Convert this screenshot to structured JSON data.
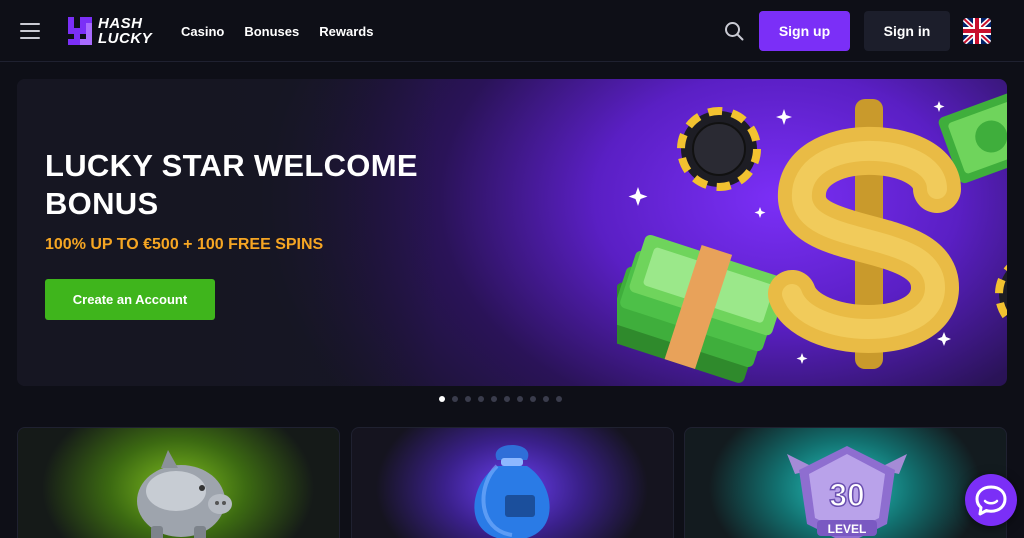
{
  "header": {
    "logo_line1": "HASH",
    "logo_line2": "LUCKY",
    "nav": [
      "Casino",
      "Bonuses",
      "Rewards"
    ],
    "signup_label": "Sign up",
    "signin_label": "Sign in"
  },
  "banner": {
    "title": "LUCKY STAR WELCOME BONUS",
    "subtitle": "100% UP TO €500 + 100 FREE SPINS",
    "cta_label": "Create an Account"
  },
  "carousel": {
    "slide_count": 10,
    "active_index": 0
  },
  "cards": [
    {
      "icon": "piggy-bank-icon",
      "accent": "#7fbd1f"
    },
    {
      "icon": "money-bag-icon",
      "accent": "#6a3ff0"
    },
    {
      "icon": "level-badge-icon",
      "badge_number": "30",
      "badge_label": "LEVEL",
      "accent": "#26c9c3"
    }
  ],
  "colors": {
    "primary": "#7b2ff7",
    "cta": "#3fb51c",
    "highlight": "#f6a623",
    "background": "#0e0f17"
  }
}
